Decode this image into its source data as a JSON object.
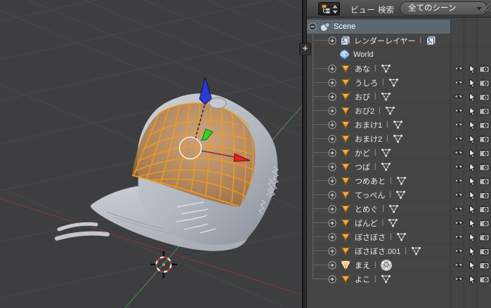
{
  "outliner_header": {
    "menu_view": "ビュー",
    "menu_search": "検索",
    "scene_selector": "全てのシーン"
  },
  "viewport": {
    "add_region_button": "+"
  },
  "tree": {
    "scene_label": "Scene",
    "render_layer_label": "レンダーレイヤー",
    "world_label": "World",
    "separator": "|",
    "objects": [
      {
        "label": "あな"
      },
      {
        "label": "うしろ"
      },
      {
        "label": "おび"
      },
      {
        "label": "おび2"
      },
      {
        "label": "おまけ1"
      },
      {
        "label": "おまけ2"
      },
      {
        "label": "かど"
      },
      {
        "label": "つば"
      },
      {
        "label": "つめあと"
      },
      {
        "label": "てっぺん"
      },
      {
        "label": "とめぐ"
      },
      {
        "label": "ばんど"
      },
      {
        "label": "ぼさぼさ"
      },
      {
        "label": "ぼさぼさ.001"
      },
      {
        "label": "まえ",
        "active": true,
        "mode": "edit"
      },
      {
        "label": "よこ"
      }
    ]
  },
  "colors": {
    "selection_highlight": "#5c6871",
    "object_icon_orange": "#e09a3e",
    "edit_mesh_orange": "#f49b1c",
    "axis_x_red": "#7a3636",
    "axis_y_green": "#4e7a4e",
    "viewport_bg": "#3c3e40"
  }
}
